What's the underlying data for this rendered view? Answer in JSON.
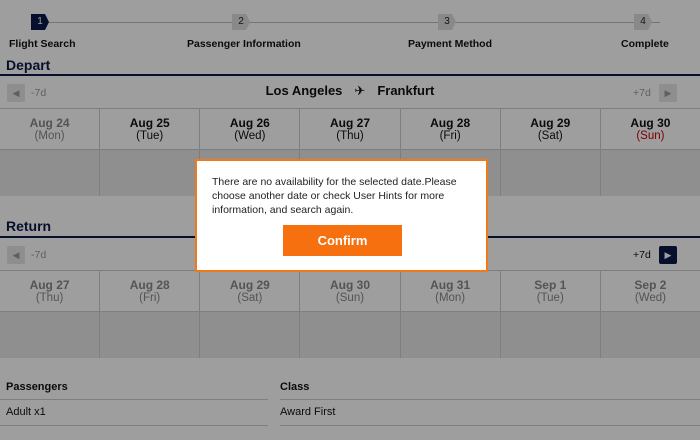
{
  "steps": [
    {
      "num": "1",
      "label": "Flight Search",
      "active": true
    },
    {
      "num": "2",
      "label": "Passenger Information",
      "active": false
    },
    {
      "num": "3",
      "label": "Payment Method",
      "active": false
    },
    {
      "num": "4",
      "label": "Complete",
      "active": false
    }
  ],
  "depart": {
    "title": "Depart",
    "prev_label": "-7d",
    "next_label": "+7d",
    "origin": "Los Angeles",
    "destination": "Frankfurt",
    "dates": [
      {
        "date": "Aug 24",
        "dow": "(Mon)"
      },
      {
        "date": "Aug 25",
        "dow": "(Tue)"
      },
      {
        "date": "Aug 26",
        "dow": "(Wed)"
      },
      {
        "date": "Aug 27",
        "dow": "(Thu)"
      },
      {
        "date": "Aug 28",
        "dow": "(Fri)"
      },
      {
        "date": "Aug 29",
        "dow": "(Sat)"
      },
      {
        "date": "Aug 30",
        "dow": "(Sun)"
      }
    ]
  },
  "return": {
    "title": "Return",
    "prev_label": "-7d",
    "next_label": "+7d",
    "dates": [
      {
        "date": "Aug 27",
        "dow": "(Thu)"
      },
      {
        "date": "Aug 28",
        "dow": "(Fri)"
      },
      {
        "date": "Aug 29",
        "dow": "(Sat)"
      },
      {
        "date": "Aug 30",
        "dow": "(Sun)"
      },
      {
        "date": "Aug 31",
        "dow": "(Mon)"
      },
      {
        "date": "Sep 1",
        "dow": "(Tue)"
      },
      {
        "date": "Sep 2",
        "dow": "(Wed)"
      }
    ]
  },
  "info": {
    "passengers_label": "Passengers",
    "passengers_value": "Adult x1",
    "class_label": "Class",
    "class_value": "Award First"
  },
  "dialog": {
    "message": "There are no availability for the selected date.Please choose another date or check User Hints for more information, and search again.",
    "confirm_label": "Confirm"
  },
  "colors": {
    "navy": "#0b1a4a",
    "orange": "#f6700f",
    "sunday_red": "#cc0000"
  }
}
